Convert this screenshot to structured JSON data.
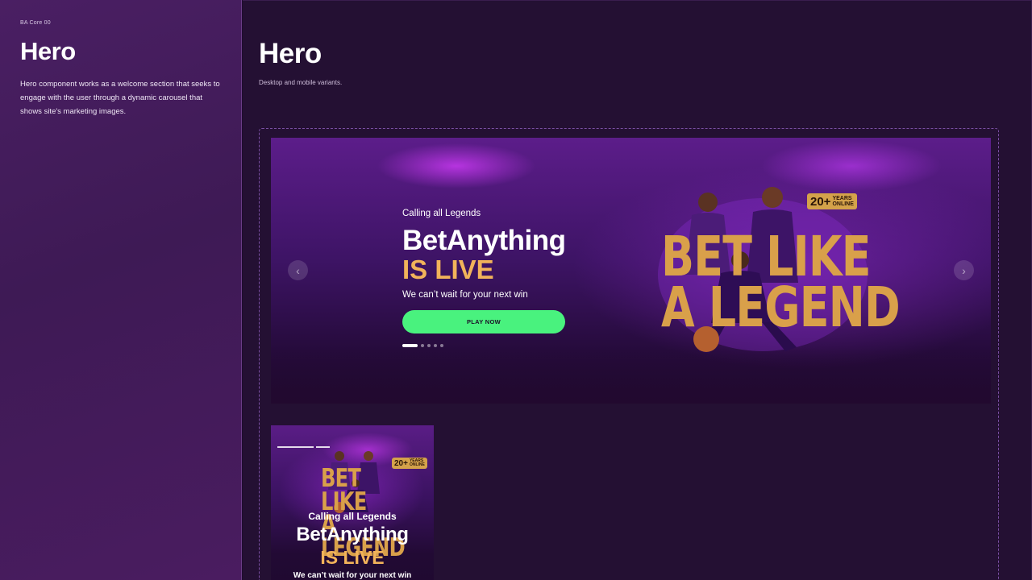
{
  "sidebar": {
    "breadcrumb": "BA Core 00",
    "title": "Hero",
    "description": "Hero component works as a welcome section that seeks to engage with the user through a dynamic carousel that shows site's marketing images."
  },
  "main": {
    "title": "Hero",
    "subtitle": "Desktop and mobile variants."
  },
  "hero_desktop": {
    "kicker": "Calling all Legends",
    "title": "BetAnything",
    "highlight": "IS LIVE",
    "tagline": "We can’t wait for your next win",
    "cta_label": "PLAY NOW",
    "promo_line1": "BET LIKE",
    "promo_line2": "A LEGEND",
    "badge_number": "20+",
    "badge_text_1": "YEARS",
    "badge_text_2": "ONLINE",
    "prev_icon": "chevron-left-icon",
    "next_icon": "chevron-right-icon",
    "slide_count": 5,
    "active_slide": 1
  },
  "hero_mobile": {
    "kicker": "Calling all Legends",
    "title": "BetAnything",
    "highlight": "IS LIVE",
    "tagline": "We can’t wait for your next win",
    "promo_line1": "BET LIKE",
    "promo_line2": "A LEGEND",
    "badge_number": "20+",
    "badge_text_1": "YEARS",
    "badge_text_2": "ONLINE"
  },
  "colors": {
    "accent_gold": "#f2b35a",
    "cta_green": "#49f27e",
    "background": "#241033",
    "sidebar": "#4a1f63"
  }
}
